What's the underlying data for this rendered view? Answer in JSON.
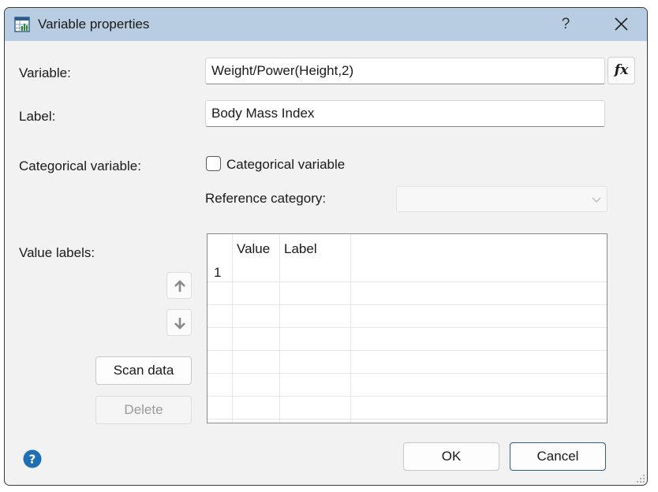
{
  "window": {
    "title": "Variable properties",
    "help_symbol": "?"
  },
  "form": {
    "variable_label": "Variable:",
    "variable_value": "Weight/Power(Height,2)",
    "fx_label": "fx",
    "label_label": "Label:",
    "label_value": "Body Mass Index",
    "categorical_label": "Categorical variable:",
    "categorical_checkbox_label": "Categorical variable",
    "categorical_checked": false,
    "reference_category_label": "Reference category:",
    "reference_category_value": ""
  },
  "value_labels": {
    "section_label": "Value labels:",
    "columns": [
      "Value",
      "Label"
    ],
    "rows": [
      {
        "num": "1",
        "value": "",
        "label": ""
      }
    ],
    "scan_button": "Scan data",
    "delete_button": "Delete"
  },
  "footer": {
    "ok": "OK",
    "cancel": "Cancel"
  },
  "icons": {
    "app": "table-chart-icon",
    "help_title": "question-mark-icon",
    "close": "close-icon",
    "move_up": "arrow-up-icon",
    "move_down": "arrow-down-icon",
    "combo": "chevron-down-icon",
    "help_footer": "help-circle-icon",
    "resize": "resize-grip-icon"
  },
  "colors": {
    "titlebar": "#b9cde2",
    "dialog_bg": "#f2f2f2",
    "help_blue": "#1f6fb5",
    "focus_border": "#2f5f8f"
  }
}
